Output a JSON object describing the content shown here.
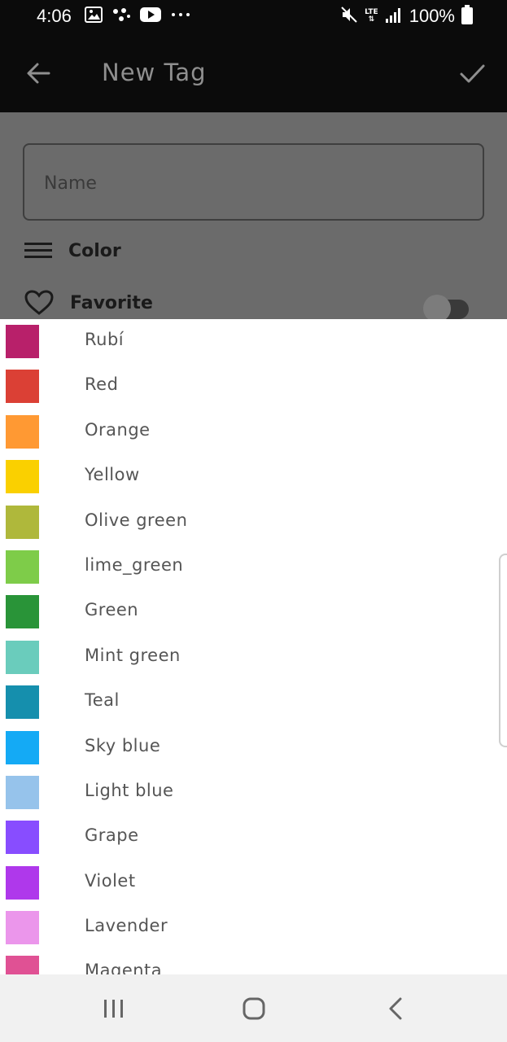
{
  "status_bar": {
    "time": "4:06",
    "network": "LTE",
    "battery": "100%",
    "left_icons": [
      "gallery-icon",
      "dots-connect-icon",
      "youtube-icon",
      "more-icon"
    ],
    "right_icons": [
      "mute-icon",
      "lte-icon",
      "signal-icon",
      "battery-icon"
    ]
  },
  "app_bar": {
    "title": "New Tag"
  },
  "form": {
    "name_placeholder": "Name",
    "name_value": "",
    "color_label": "Color",
    "favorite_label": "Favorite",
    "favorite_on": false
  },
  "colors": [
    {
      "name": "Rubí",
      "color": "#B8206A"
    },
    {
      "name": "Red",
      "color": "#DB4035"
    },
    {
      "name": "Orange",
      "color": "#FF9933"
    },
    {
      "name": "Yellow",
      "color": "#FAD000"
    },
    {
      "name": "Olive green",
      "color": "#AFB83B"
    },
    {
      "name": "lime_green",
      "color": "#7ECC49"
    },
    {
      "name": "Green",
      "color": "#299438"
    },
    {
      "name": "Mint green",
      "color": "#6ACCBC"
    },
    {
      "name": "Teal",
      "color": "#158FAD"
    },
    {
      "name": "Sky blue",
      "color": "#14AAF5"
    },
    {
      "name": "Light blue",
      "color": "#96C3EB"
    },
    {
      "name": "Grape",
      "color": "#884DFF"
    },
    {
      "name": "Violet",
      "color": "#AF38EB"
    },
    {
      "name": "Lavender",
      "color": "#EB96EB"
    },
    {
      "name": "Magenta",
      "color": "#E05194"
    }
  ]
}
